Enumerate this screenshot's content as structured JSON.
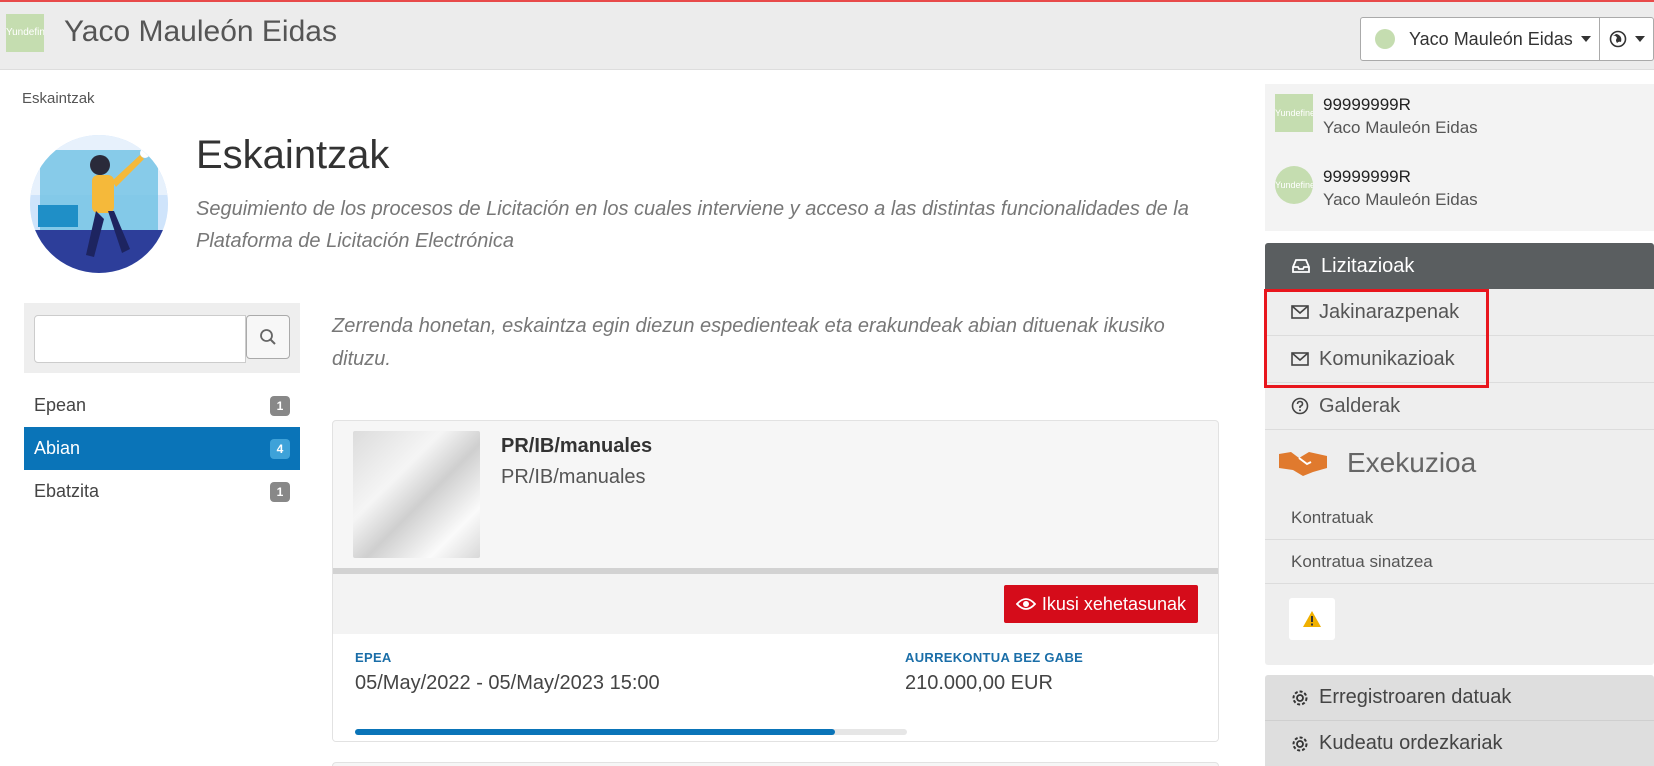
{
  "header": {
    "logo_text": "Yundefined",
    "title": "Yaco Mauleón Eidas",
    "user_menu_label": "Yaco Mauleón Eidas",
    "lang_icon": "globe-icon"
  },
  "breadcrumb": "Eskaintzak",
  "page": {
    "title": "Eskaintzak",
    "subtitle": "Seguimiento de los procesos de Licitación en los cuales interviene y acceso a las distintas funcionalidades de la Plataforma de Licitación Electrónica",
    "intro": "Zerrenda honetan, eskaintza egin diezun espedienteak eta erakundeak abian dituenak ikusiko dituzu."
  },
  "search": {
    "placeholder": ""
  },
  "filters": [
    {
      "label": "Epean",
      "count": "1",
      "active": false
    },
    {
      "label": "Abian",
      "count": "4",
      "active": true
    },
    {
      "label": "Ebatzita",
      "count": "1",
      "active": false
    }
  ],
  "card": {
    "title": "PR/IB/manuales",
    "subtitle": "PR/IB/manuales",
    "detail_button": "Ikusi xehetasunak",
    "period_label": "EPEA",
    "period_value": "05/May/2022 - 05/May/2023 15:00",
    "budget_label": "AURREKONTUA BEZ GABE",
    "budget_value": "210.000,00 EUR",
    "progress": 0.87
  },
  "profile": [
    {
      "logo": "Yundefined",
      "id": "99999999R",
      "name": "Yaco Mauleón Eidas"
    },
    {
      "logo": "Yundefined",
      "id": "99999999R",
      "name": "Yaco Mauleón Eidas"
    }
  ],
  "sidebar": {
    "head": "Lizitazioak",
    "items": [
      {
        "label": "Jakinarazpenak",
        "icon": "envelope-icon"
      },
      {
        "label": "Komunikazioak",
        "icon": "envelope-icon"
      },
      {
        "label": "Galderak",
        "icon": "question-circle-icon"
      }
    ],
    "exec_title": "Exekuzioa",
    "exec_items": [
      {
        "label": "Kontratuak"
      },
      {
        "label": "Kontratua sinatzea"
      }
    ],
    "bottom_items": [
      {
        "label": "Erregistroaren datuak",
        "icon": "gear-icon"
      },
      {
        "label": "Kudeatu ordezkariak",
        "icon": "gear-icon"
      }
    ]
  },
  "colors": {
    "accent": "#0a74b8",
    "danger": "#d50c1a",
    "highlight": "#e8161d",
    "sidebar_head": "#5a5e60"
  }
}
